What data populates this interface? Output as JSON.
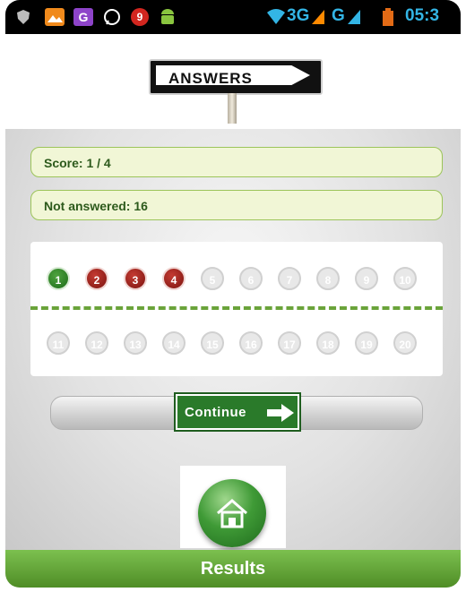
{
  "status_bar": {
    "network_3g": "3G",
    "network_g": "G",
    "time": "05:3",
    "icons": [
      "shield-icon",
      "gallery-icon",
      "g-app-icon",
      "whatsapp-icon",
      "badge-icon",
      "android-icon",
      "wifi-icon",
      "signal-icon",
      "battery-icon"
    ],
    "notification_badge": "9"
  },
  "header": {
    "sign_text": "ANSWERS"
  },
  "score": {
    "label": "Score: 1 / 4"
  },
  "not_answered": {
    "label": "Not answered: 16"
  },
  "questions": {
    "row1": [
      {
        "n": "1",
        "state": "correct"
      },
      {
        "n": "2",
        "state": "wrong"
      },
      {
        "n": "3",
        "state": "wrong"
      },
      {
        "n": "4",
        "state": "wrong"
      },
      {
        "n": "5",
        "state": "na"
      },
      {
        "n": "6",
        "state": "na"
      },
      {
        "n": "7",
        "state": "na"
      },
      {
        "n": "8",
        "state": "na"
      },
      {
        "n": "9",
        "state": "na"
      },
      {
        "n": "10",
        "state": "na"
      }
    ],
    "row2": [
      {
        "n": "11",
        "state": "na"
      },
      {
        "n": "12",
        "state": "na"
      },
      {
        "n": "13",
        "state": "na"
      },
      {
        "n": "14",
        "state": "na"
      },
      {
        "n": "15",
        "state": "na"
      },
      {
        "n": "16",
        "state": "na"
      },
      {
        "n": "17",
        "state": "na"
      },
      {
        "n": "18",
        "state": "na"
      },
      {
        "n": "19",
        "state": "na"
      },
      {
        "n": "20",
        "state": "na"
      }
    ]
  },
  "continue_button": {
    "label": "Continue"
  },
  "footer": {
    "title": "Results"
  },
  "colors": {
    "correct": "#1c6b18",
    "wrong": "#7c1410",
    "accent": "#4f8d26"
  }
}
